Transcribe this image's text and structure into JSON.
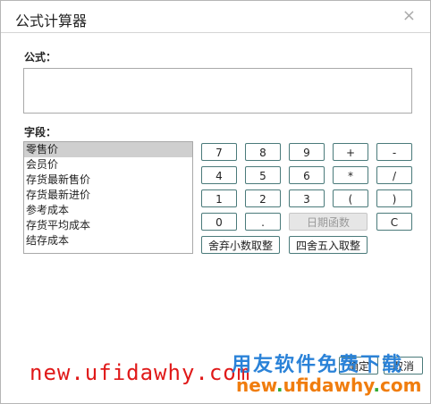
{
  "dialog": {
    "title": "公式计算器",
    "close_glyph": "×"
  },
  "formula": {
    "label": "公式：",
    "value": ""
  },
  "fields": {
    "label": "字段：",
    "items": [
      "零售价",
      "会员价",
      "存货最新售价",
      "存货最新进价",
      "参考成本",
      "存货平均成本",
      "结存成本"
    ],
    "selected_index": 0
  },
  "keypad": {
    "row1": [
      "7",
      "8",
      "9",
      "+",
      "-"
    ],
    "row2": [
      "4",
      "5",
      "6",
      "*",
      "/"
    ],
    "row3": [
      "1",
      "2",
      "3",
      "(",
      ")"
    ],
    "row4": [
      "0",
      ".",
      "日期函数",
      "C"
    ],
    "truncate_label": "舍弃小数取整",
    "round_label": "四舍五入取整"
  },
  "footer": {
    "ok_label": "确定",
    "cancel_label": "取消"
  },
  "watermark": {
    "url_red": "new.ufidawhy.com",
    "brand": "用友软件免费下载",
    "url_color_parts": [
      "new",
      ".",
      "ufidawhy",
      ".",
      "com"
    ]
  }
}
